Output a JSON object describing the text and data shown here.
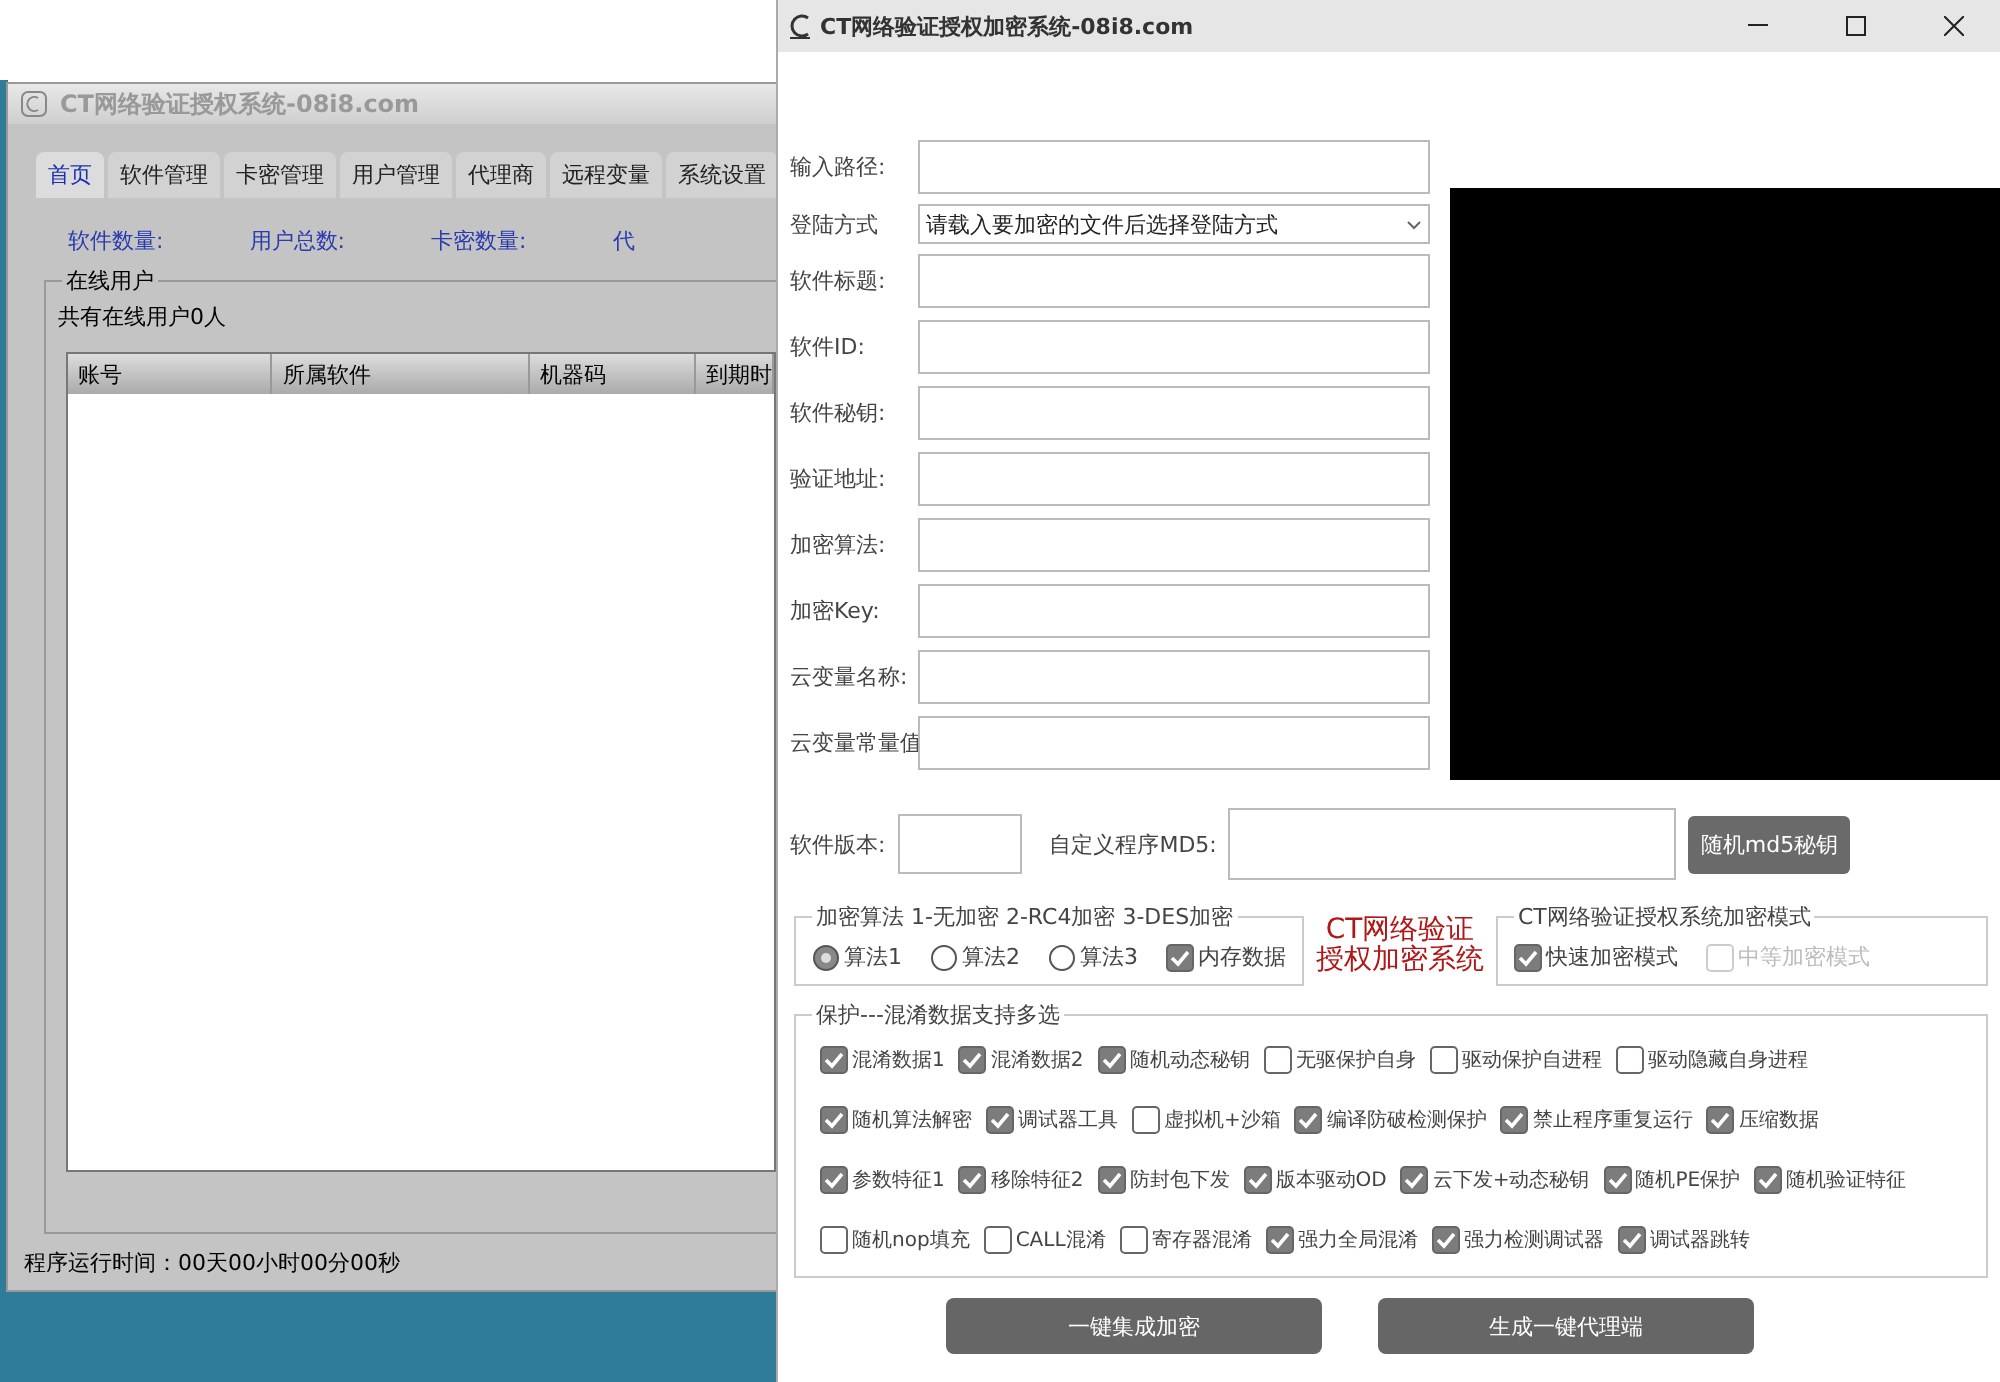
{
  "background_window": {
    "title": "CT网络验证授权系统-08i8.com",
    "tabs": [
      {
        "label": "首页",
        "selected": true
      },
      {
        "label": "软件管理",
        "selected": false
      },
      {
        "label": "卡密管理",
        "selected": false
      },
      {
        "label": "用户管理",
        "selected": false
      },
      {
        "label": "代理商",
        "selected": false
      },
      {
        "label": "远程变量",
        "selected": false
      },
      {
        "label": "系统设置",
        "selected": false
      }
    ],
    "stats": [
      "软件数量:",
      "用户总数:",
      "卡密数量:",
      "代"
    ],
    "group_title": "在线用户",
    "online_count": "共有在线用户0人",
    "columns": [
      "账号",
      "所属软件",
      "机器码",
      "到期时"
    ],
    "status": "程序运行时间：00天00小时00分00秒"
  },
  "main_window": {
    "title": "CT网络验证授权加密系统-08i8.com",
    "fields": [
      {
        "label": "输入路径:",
        "kind": "text"
      },
      {
        "label": "登陆方式",
        "kind": "select",
        "value": "请载入要加密的文件后选择登陆方式"
      },
      {
        "label": "软件标题:",
        "kind": "text"
      },
      {
        "label": "软件ID:",
        "kind": "text"
      },
      {
        "label": "软件秘钥:",
        "kind": "text"
      },
      {
        "label": "验证地址:",
        "kind": "text"
      },
      {
        "label": "加密算法:",
        "kind": "text"
      },
      {
        "label": "加密Key:",
        "kind": "text"
      },
      {
        "label": "云变量名称:",
        "kind": "text"
      },
      {
        "label": "云变量常量值",
        "kind": "text"
      }
    ],
    "version_label": "软件版本:",
    "md5_label": "自定义程序MD5:",
    "md5_button": "随机md5秘钥",
    "algo_group": {
      "title": "加密算法 1-无加密 2-RC4加密 3-DES加密",
      "radios": [
        {
          "label": "算法1",
          "selected": true
        },
        {
          "label": "算法2",
          "selected": false
        },
        {
          "label": "算法3",
          "selected": false
        }
      ],
      "memory": {
        "label": "内存数据",
        "checked": true
      }
    },
    "brand_text": "CT网络验证授权加密系统",
    "mode_group": {
      "title": "CT网络验证授权系统加密模式",
      "options": [
        {
          "label": "快速加密模式",
          "checked": true,
          "disabled": false
        },
        {
          "label": "中等加密模式",
          "checked": false,
          "disabled": true
        }
      ]
    },
    "protect_group": {
      "title": "保护---混淆数据支持多选",
      "rows": [
        [
          {
            "label": "混淆数据1",
            "checked": true
          },
          {
            "label": "混淆数据2",
            "checked": true
          },
          {
            "label": "随机动态秘钥",
            "checked": true
          },
          {
            "label": "无驱保护自身",
            "checked": false
          },
          {
            "label": "驱动保护自进程",
            "checked": false
          },
          {
            "label": "驱动隐藏自身进程",
            "checked": false
          }
        ],
        [
          {
            "label": "随机算法解密",
            "checked": true
          },
          {
            "label": "调试器工具",
            "checked": true
          },
          {
            "label": "虚拟机+沙箱",
            "checked": false
          },
          {
            "label": "编译防破检测保护",
            "checked": true
          },
          {
            "label": "禁止程序重复运行",
            "checked": true
          },
          {
            "label": "压缩数据",
            "checked": true
          }
        ],
        [
          {
            "label": "参数特征1",
            "checked": true
          },
          {
            "label": "移除特征2",
            "checked": true
          },
          {
            "label": "防封包下发",
            "checked": true
          },
          {
            "label": "版本驱动OD",
            "checked": true
          },
          {
            "label": "云下发+动态秘钥",
            "checked": true
          },
          {
            "label": "随机PE保护",
            "checked": true
          },
          {
            "label": "随机验证特征",
            "checked": true
          }
        ],
        [
          {
            "label": "随机nop填充",
            "checked": false
          },
          {
            "label": "CALL混淆",
            "checked": false
          },
          {
            "label": "寄存器混淆",
            "checked": false
          },
          {
            "label": "强力全局混淆",
            "checked": true
          },
          {
            "label": "强力检测调试器",
            "checked": true
          },
          {
            "label": "调试器跳转",
            "checked": true
          }
        ]
      ]
    },
    "buttons": [
      "一键集成加密",
      "生成一键代理端"
    ]
  }
}
